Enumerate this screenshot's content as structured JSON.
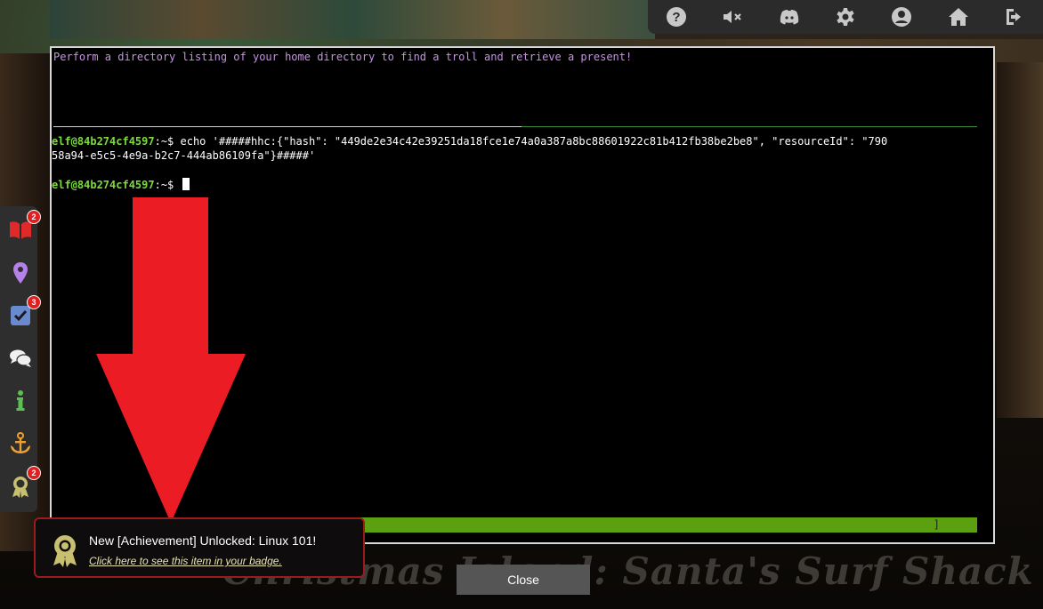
{
  "window": {
    "watermark_text": "Christmas Island: Santa's Surf Shack"
  },
  "toolbar": {
    "items": [
      {
        "icon": "help-icon"
      },
      {
        "icon": "mute-icon"
      },
      {
        "icon": "discord-icon"
      },
      {
        "icon": "gear-icon"
      },
      {
        "icon": "user-icon"
      },
      {
        "icon": "home-icon"
      },
      {
        "icon": "logout-icon"
      }
    ]
  },
  "terminal": {
    "objective": "Perform a directory listing of your home directory to find a troll and retrieve a present!",
    "prompt_user": "elf@84b274cf4597",
    "prompt_suffix": ":~$ ",
    "command_line_1": "echo '#####hhc:{\"hash\": \"449de2e34c42e39251da18fce1e74a0a387a8bc88601922c81b412fb38be2be8\", \"resourceId\": \"790",
    "command_line_2": "58a94-e5c5-4e9a-b2c7-444ab86109fa\"}#####'",
    "progress_bracket": "]",
    "colors": {
      "prompt": "#7cdc3c",
      "objective": "#c792e6",
      "progress": "#5aa010"
    }
  },
  "sidebar": {
    "items": [
      {
        "icon": "book-icon",
        "badge": "2"
      },
      {
        "icon": "location-pin-icon",
        "badge": ""
      },
      {
        "icon": "checklist-icon",
        "badge": "3"
      },
      {
        "icon": "chat-icon",
        "badge": ""
      },
      {
        "icon": "info-icon",
        "badge": ""
      },
      {
        "icon": "anchor-icon",
        "badge": ""
      },
      {
        "icon": "achievement-icon",
        "badge": "2"
      }
    ]
  },
  "toast": {
    "title": "New [Achievement] Unlocked: Linux 101!",
    "link_text": "Click here to see this item in your badge."
  },
  "close_button": {
    "label": "Close"
  }
}
